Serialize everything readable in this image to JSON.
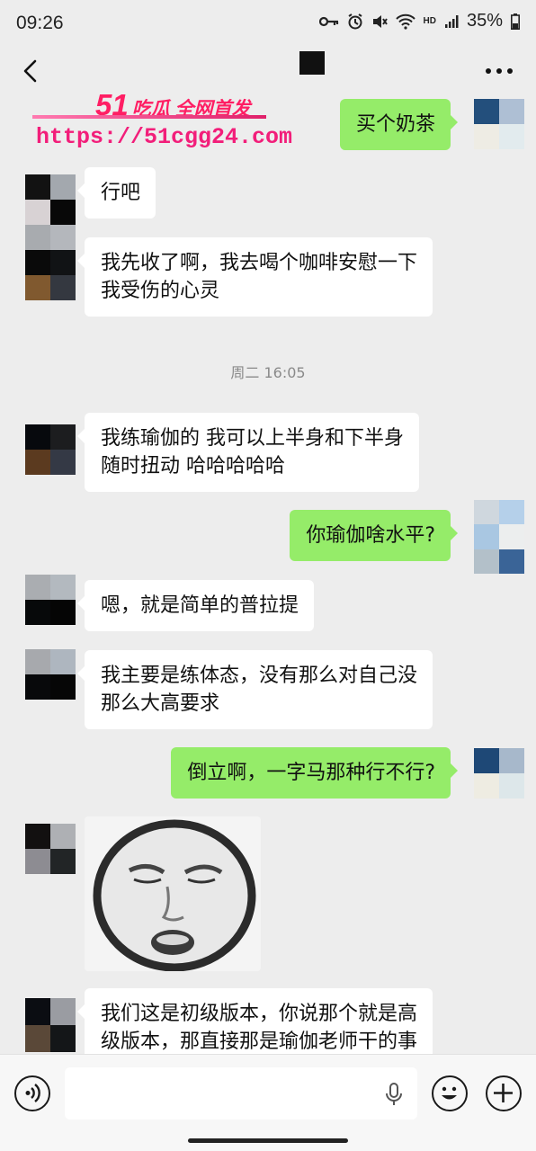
{
  "status_bar": {
    "time": "09:26",
    "battery": "35%",
    "network": "HD"
  },
  "watermark": {
    "brand": "51",
    "brand_text": "吃瓜 全网首发",
    "url": "https://51cgg24.com"
  },
  "timestamp": "周二 16:05",
  "messages": [
    {
      "side": "out",
      "lines": [
        "买个奶茶"
      ]
    },
    {
      "side": "in",
      "lines": [
        "行吧"
      ]
    },
    {
      "side": "in",
      "lines": [
        "我先收了啊，我去喝个咖啡安慰一下",
        "我受伤的心灵"
      ]
    },
    {
      "side": "in",
      "lines": [
        "我练瑜伽的 我可以上半身和下半身",
        "随时扭动 哈哈哈哈哈"
      ]
    },
    {
      "side": "out",
      "lines": [
        "你瑜伽啥水平?"
      ]
    },
    {
      "side": "in",
      "lines": [
        "嗯，就是简单的普拉提"
      ]
    },
    {
      "side": "in",
      "lines": [
        "我主要是练体态，没有那么对自己没",
        "那么大高要求"
      ]
    },
    {
      "side": "out",
      "lines": [
        "倒立啊，一字马那种行不行?"
      ]
    },
    {
      "side": "in",
      "type": "sticker",
      "lines": []
    },
    {
      "side": "in",
      "lines": [
        "我们这是初级版本，你说那个就是高",
        "级版本，那直接那是瑜伽老师干的事"
      ]
    }
  ],
  "colors": {
    "background": "#ededed",
    "outgoing_bubble": "#95ec69",
    "incoming_bubble": "#ffffff"
  },
  "icons": [
    "back-icon",
    "more-icon",
    "voice-icon",
    "mic-icon",
    "emoji-icon",
    "plus-icon"
  ]
}
